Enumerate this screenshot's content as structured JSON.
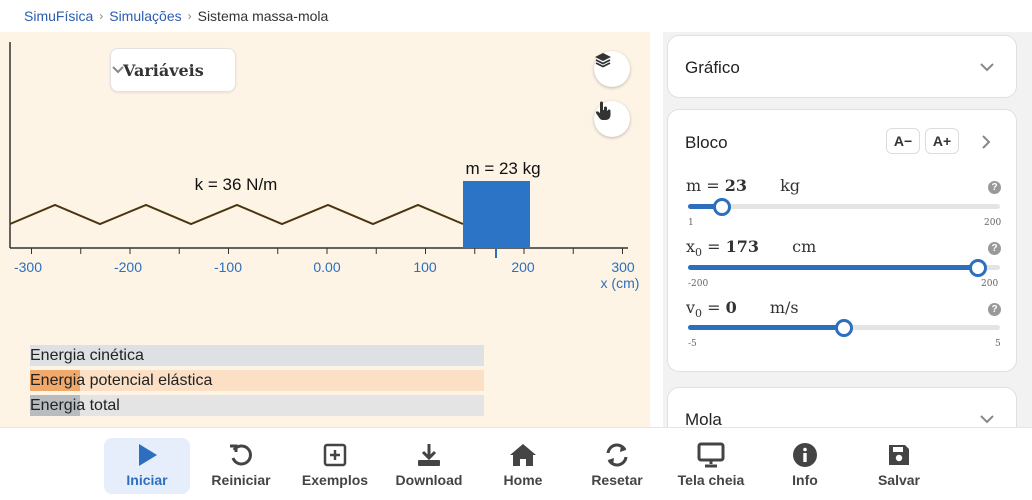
{
  "breadcrumb": {
    "items": [
      "SimuFísica",
      "Simulações",
      "Sistema massa-mola"
    ]
  },
  "sim": {
    "variables_label": "Variáveis",
    "spring_label": "k = 36 N/m",
    "mass_label": "m = 23 kg",
    "axis_ticks": [
      "-300",
      "-200",
      "-100",
      "0.00",
      "100",
      "200",
      "300"
    ],
    "axis_label": "x (cm)",
    "energy": [
      {
        "label": "Energia cinética",
        "level": 0.0,
        "fill": "#c9d0d6",
        "bg": "#dde1e4"
      },
      {
        "label": "Energia potencial elástica",
        "level": 0.11,
        "fill": "#f0a96a",
        "bg": "#fbe0c6"
      },
      {
        "label": "Energia total",
        "level": 0.11,
        "fill": "#b9bcbf",
        "bg": "#e4e4e4"
      }
    ],
    "block_color": "#2b74c6"
  },
  "panel": {
    "grafico_title": "Gráfico",
    "bloco_title": "Bloco",
    "font_down": "A−",
    "font_up": "A+",
    "mola_title": "Mola",
    "help_symbol": "?",
    "params": [
      {
        "name": "m",
        "sub": "",
        "eq": " = ",
        "value": "23",
        "unit": "kg",
        "min": "1",
        "max": "200",
        "level": 0.11
      },
      {
        "name": "x",
        "sub": "0",
        "eq": " = ",
        "value": "173",
        "unit": "cm",
        "min": "-200",
        "max": "200",
        "level": 0.93
      },
      {
        "name": "v",
        "sub": "0",
        "eq": " = ",
        "value": "0",
        "unit": "m/s",
        "min": "-5",
        "max": "5",
        "level": 0.5
      }
    ]
  },
  "toolbar": {
    "buttons": [
      {
        "label": "Iniciar",
        "icon": "play-icon"
      },
      {
        "label": "Reiniciar",
        "icon": "restart-icon"
      },
      {
        "label": "Exemplos",
        "icon": "plus-square-icon"
      },
      {
        "label": "Download",
        "icon": "download-icon"
      },
      {
        "label": "Home",
        "icon": "home-icon"
      },
      {
        "label": "Resetar",
        "icon": "sync-icon"
      },
      {
        "label": "Tela cheia",
        "icon": "monitor-icon"
      },
      {
        "label": "Info",
        "icon": "info-icon"
      },
      {
        "label": "Salvar",
        "icon": "save-icon"
      }
    ]
  },
  "colors": {
    "accent": "#2c6fbf",
    "sim_bg": "#fdf4e6",
    "spring": "#4a3510"
  }
}
